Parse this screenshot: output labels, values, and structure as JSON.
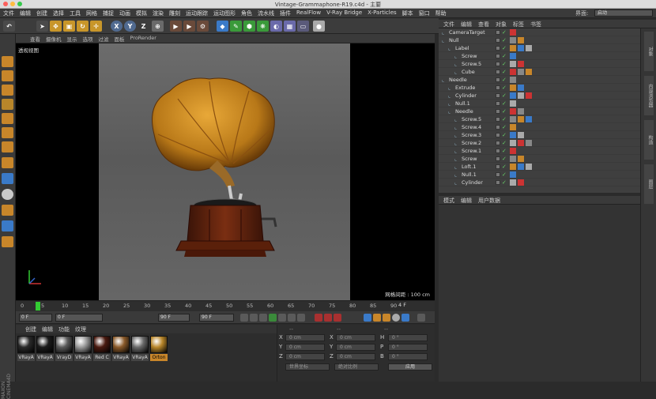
{
  "window": {
    "title": "Vintage-Grammaphone-R19.c4d - 主要"
  },
  "menubar": {
    "items": [
      "文件",
      "编辑",
      "创建",
      "选择",
      "工具",
      "网格",
      "捕捉",
      "动画",
      "模拟",
      "渲染",
      "雕刻",
      "运动跟踪",
      "运动图形",
      "角色",
      "流水线",
      "插件",
      "RealFlow",
      "V-Ray Bridge",
      "X-Particles",
      "脚本",
      "窗口",
      "帮助"
    ],
    "layout_label": "界面:",
    "layout_value": "启动"
  },
  "toolbar": {
    "axis_x": "X",
    "axis_y": "Y",
    "axis_z": "Z"
  },
  "viewport": {
    "menu": [
      "查看",
      "摄像机",
      "显示",
      "选项",
      "过滤",
      "面板",
      "ProRender"
    ],
    "label": "透视视图",
    "grid_spacing": "网格间距 : 100 cm"
  },
  "timeline": {
    "ticks": [
      "0",
      "5",
      "10",
      "15",
      "20",
      "25",
      "30",
      "35",
      "40",
      "45",
      "50",
      "55",
      "60",
      "65",
      "70",
      "75",
      "80",
      "85",
      "90"
    ],
    "current_frame": "4 F"
  },
  "playback": {
    "start": "0 F",
    "start2": "0 F",
    "end": "90 F",
    "end2": "90 F"
  },
  "materials": {
    "menu": [
      "创建",
      "编辑",
      "功能",
      "纹理"
    ],
    "items": [
      {
        "name": "VRayA",
        "color": "#2a2a2a"
      },
      {
        "name": "VRayA",
        "color": "#1c1c1c"
      },
      {
        "name": "VrayD",
        "color": "#5a5a5a"
      },
      {
        "name": "VRayA",
        "color": "#9a9a9a"
      },
      {
        "name": "Red C",
        "color": "#4a1a10"
      },
      {
        "name": "VRayA",
        "color": "#8a5a2a"
      },
      {
        "name": "VRayA",
        "color": "#6a6a6a"
      },
      {
        "name": "Orton",
        "color": "#b8862a"
      }
    ],
    "logo": "MAXON CINEMA4D"
  },
  "coords": {
    "header": [
      "--",
      "--",
      "--"
    ],
    "rows": [
      {
        "a": "X",
        "av": "0 cm",
        "b": "X",
        "bv": "0 cm",
        "c": "H",
        "cv": "0 °"
      },
      {
        "a": "Y",
        "av": "0 cm",
        "b": "Y",
        "bv": "0 cm",
        "c": "P",
        "cv": "0 °"
      },
      {
        "a": "Z",
        "av": "0 cm",
        "b": "Z",
        "bv": "0 cm",
        "c": "B",
        "cv": "0 °"
      }
    ],
    "mode": "世界坐标",
    "scale": "绝对比例",
    "apply": "应用"
  },
  "object_manager": {
    "menu": [
      "文件",
      "编辑",
      "查看",
      "对象",
      "标签",
      "书签"
    ],
    "rows": [
      {
        "name": "CameraTarget",
        "indent": 0
      },
      {
        "name": "Null",
        "indent": 0
      },
      {
        "name": "Label",
        "indent": 1
      },
      {
        "name": "Screw",
        "indent": 2
      },
      {
        "name": "Screw.5",
        "indent": 2
      },
      {
        "name": "Cube",
        "indent": 2
      },
      {
        "name": "Needle",
        "indent": 0
      },
      {
        "name": "Extrude",
        "indent": 1
      },
      {
        "name": "Cylinder",
        "indent": 1
      },
      {
        "name": "Null.1",
        "indent": 1
      },
      {
        "name": "Needle",
        "indent": 1
      },
      {
        "name": "Screw.5",
        "indent": 2
      },
      {
        "name": "Screw.4",
        "indent": 2
      },
      {
        "name": "Screw.3",
        "indent": 2
      },
      {
        "name": "Screw.2",
        "indent": 2
      },
      {
        "name": "Screw.1",
        "indent": 2
      },
      {
        "name": "Screw",
        "indent": 2
      },
      {
        "name": "Loft.1",
        "indent": 2
      },
      {
        "name": "Null.1",
        "indent": 2
      },
      {
        "name": "Cylinder",
        "indent": 2
      }
    ]
  },
  "attributes": {
    "menu": [
      "模式",
      "编辑",
      "用户数据"
    ]
  },
  "right_tabs": [
    "对象",
    "内容浏览器",
    "构造",
    "图层"
  ]
}
